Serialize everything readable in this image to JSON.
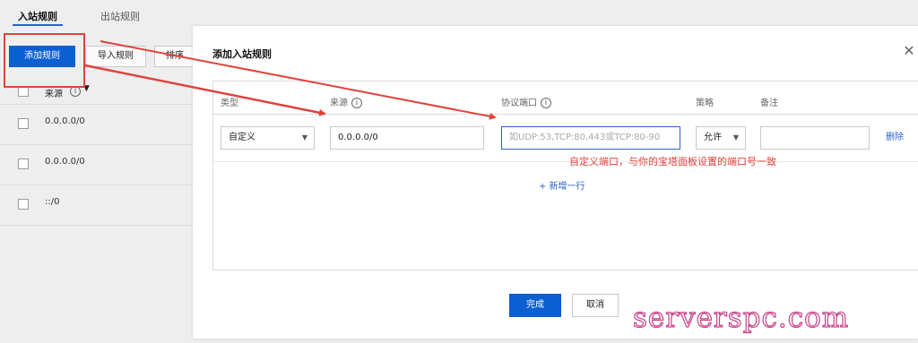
{
  "tabs": {
    "inbound": "入站规则",
    "outbound": "出站规则"
  },
  "toolbar": {
    "add": "添加规则",
    "import": "导入规则",
    "sort": "排序"
  },
  "list": {
    "header_source": "来源",
    "info_icon": "info-icon",
    "filter_icon": "filter-icon",
    "rows": [
      "0.0.0.0/0",
      "0.0.0.0/0",
      "::/0"
    ]
  },
  "dialog": {
    "title": "添加入站规则",
    "close_icon": "close-icon",
    "columns": {
      "type": "类型",
      "source": "来源",
      "port": "协议端口",
      "policy": "策略",
      "note": "备注"
    },
    "row": {
      "type_value": "自定义",
      "source_value": "0.0.0.0/0",
      "port_placeholder": "如UDP:53,TCP:80,443或TCP:80-90",
      "policy_value": "允许",
      "note_value": "",
      "delete_label": "删除"
    },
    "add_row": "+ 新增一行",
    "confirm": "完成",
    "cancel": "取消"
  },
  "annotation": "自定义端口，与你的宝塔面板设置的端口号一致",
  "watermark": "serverspc.com",
  "colors": {
    "accent": "#0a5fd1",
    "annotation": "#e0423b",
    "watermark": "#c8408a"
  }
}
